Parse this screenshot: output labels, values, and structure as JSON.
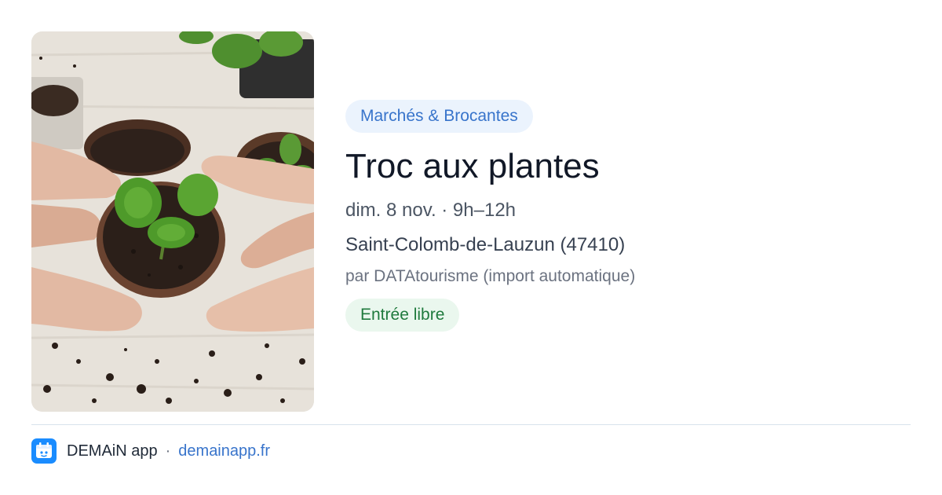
{
  "event": {
    "category": "Marchés & Brocantes",
    "title": "Troc aux plantes",
    "datetime": "dim. 8 nov. · 9h–12h",
    "location": "Saint-Colomb-de-Lauzun (47410)",
    "source": "par DATAtourisme (import automatique)",
    "price": "Entrée libre",
    "image": "photo-hands-holding-potted-seedling"
  },
  "footer": {
    "app_name": "DEMAiN app",
    "separator": "·",
    "site": "demainapp.fr",
    "icon": "demain-app-logo-icon"
  },
  "colors": {
    "category_bg": "#ebf3fd",
    "category_text": "#3874cb",
    "price_bg": "#eaf7ee",
    "price_text": "#1f7a3d",
    "link": "#3874cb",
    "brand": "#1a8cff"
  }
}
